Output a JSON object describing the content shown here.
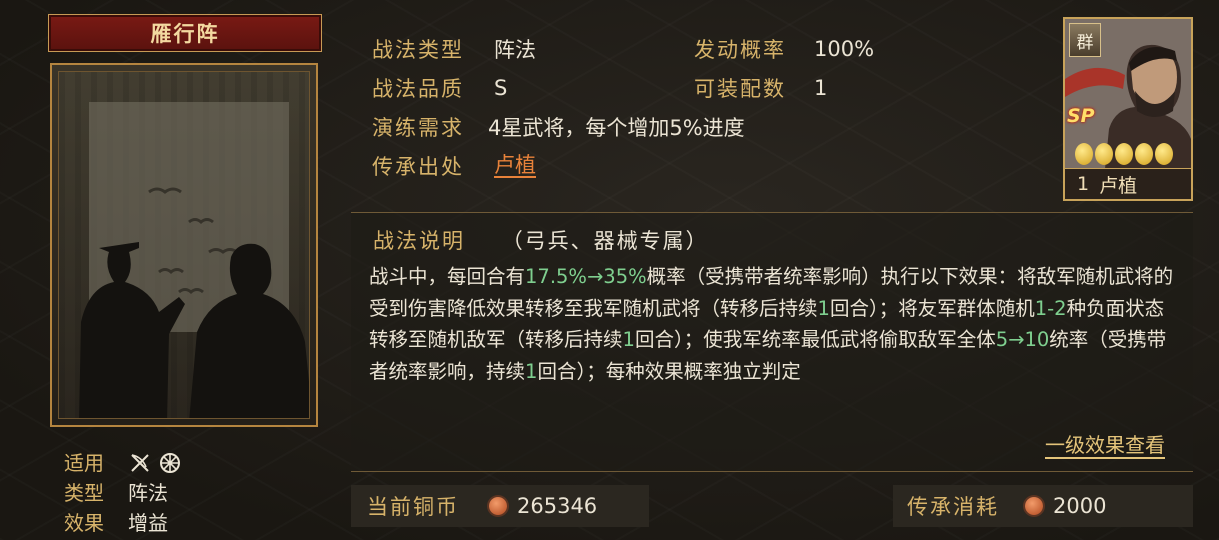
{
  "tactic": {
    "name": "雁行阵"
  },
  "info": {
    "type_label": "战法类型",
    "type_value": "阵法",
    "chance_label": "发动概率",
    "chance_value": "100%",
    "quality_label": "战法品质",
    "quality_value": "S",
    "slots_label": "可装配数",
    "slots_value": "1",
    "training_label": "演练需求",
    "training_value": "4星武将，每个增加5%进度",
    "source_label": "传承出处",
    "source_value": "卢植"
  },
  "card": {
    "faction": "群",
    "badge": "SP",
    "star_count": 5,
    "level": "1",
    "name": "卢植"
  },
  "meta": {
    "applies_label": "适用",
    "applies_icons": [
      "bow-crossed-icon",
      "siege-wheel-icon"
    ],
    "category_label": "类型",
    "category_value": "阵法",
    "effect_label": "效果",
    "effect_value": "增益"
  },
  "description": {
    "heading": "战法说明",
    "restriction": "（弓兵、器械专属）",
    "segments": [
      {
        "t": "战斗中，每回合有",
        "g": false
      },
      {
        "t": "17.5%→35%",
        "g": true
      },
      {
        "t": "概率（受携带者统率影响）执行以下效果：将敌军随机武将的受到伤害降低效果转移至我军随机武将（转移后持续",
        "g": false
      },
      {
        "t": "1",
        "g": true
      },
      {
        "t": "回合）；将友军群体随机",
        "g": false
      },
      {
        "t": "1-2",
        "g": true
      },
      {
        "t": "种负面状态转移至随机敌军（转移后持续",
        "g": false
      },
      {
        "t": "1",
        "g": true
      },
      {
        "t": "回合）；使我军统率最低武将偷取敌军全体",
        "g": false
      },
      {
        "t": "5→10",
        "g": true
      },
      {
        "t": "统率（受携带者统率影响，持续",
        "g": false
      },
      {
        "t": "1",
        "g": true
      },
      {
        "t": "回合）；每种效果概率独立判定",
        "g": false
      }
    ],
    "more_link": "一级效果查看"
  },
  "bottom": {
    "coins_label": "当前铜币",
    "coins_value": "265346",
    "cost_label": "传承消耗",
    "cost_value": "2000"
  },
  "colors": {
    "gold_label": "#d7b36a",
    "highlight_green": "#7fcf8f",
    "link_orange": "#e8823a",
    "title_red": "#7a1a14"
  }
}
